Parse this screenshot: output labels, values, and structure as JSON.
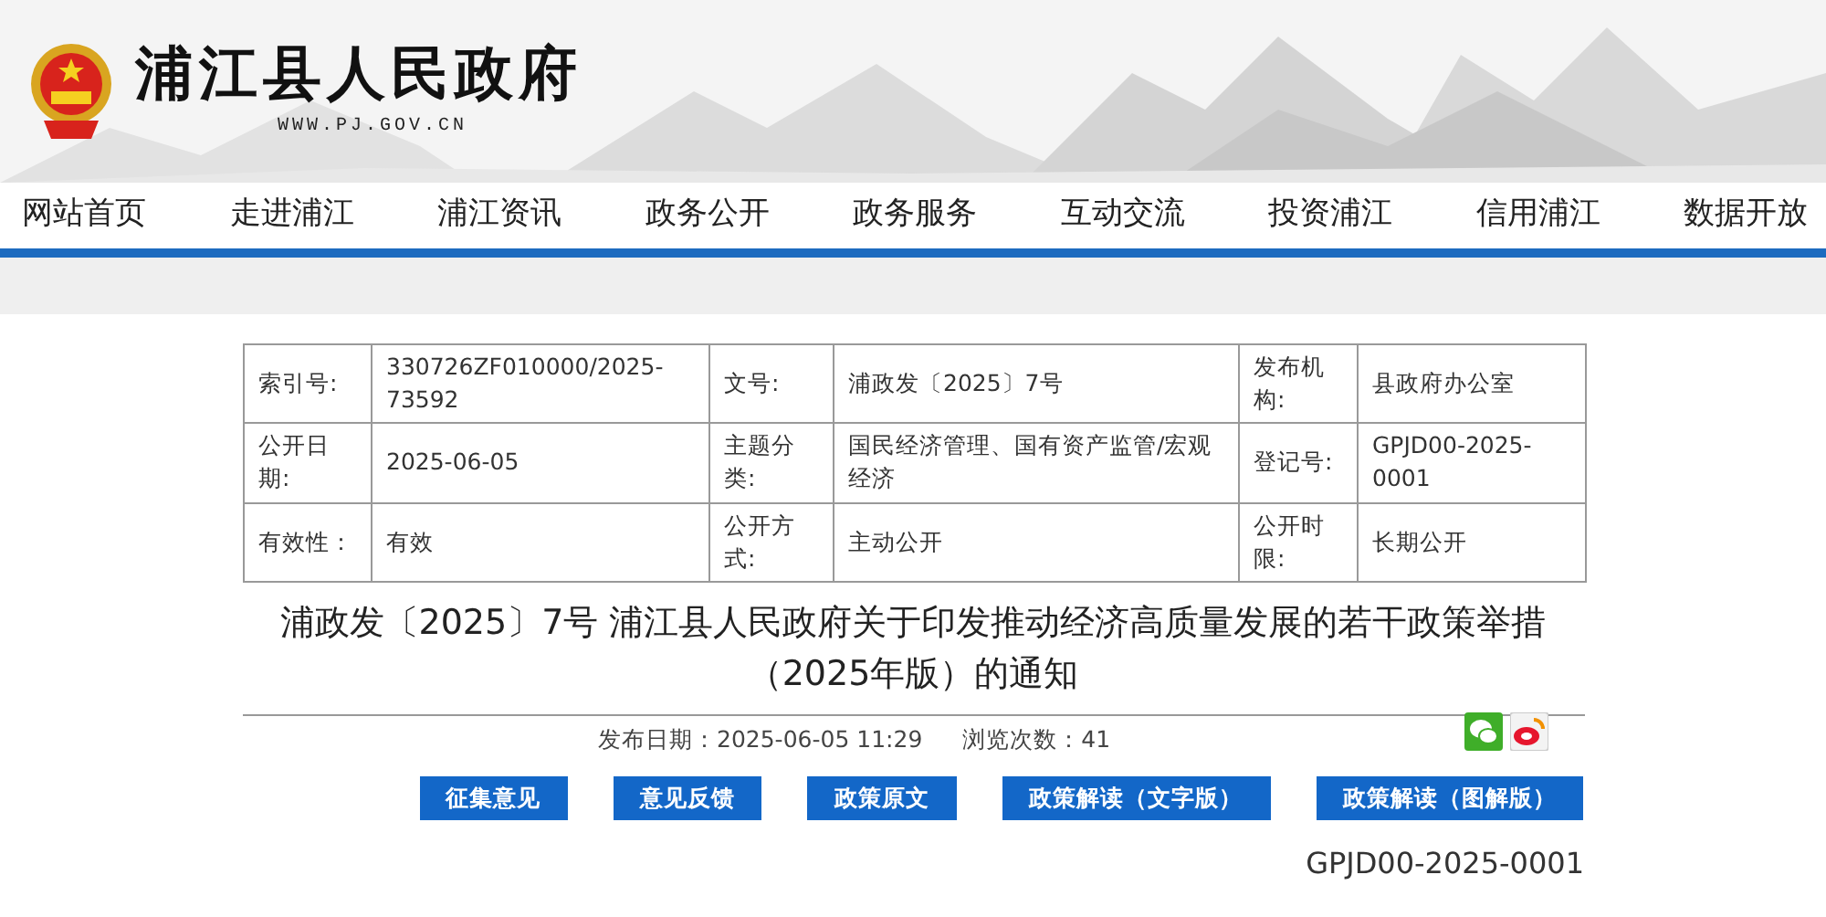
{
  "header": {
    "title": "浦江县人民政府",
    "url": "WWW.PJ.GOV.CN"
  },
  "nav": [
    {
      "label": "网站首页"
    },
    {
      "label": "走进浦江"
    },
    {
      "label": "浦江资讯"
    },
    {
      "label": "政务公开"
    },
    {
      "label": "政务服务"
    },
    {
      "label": "互动交流"
    },
    {
      "label": "投资浦江"
    },
    {
      "label": "信用浦江"
    },
    {
      "label": "数据开放"
    }
  ],
  "info_table": {
    "rows": [
      [
        {
          "label": "索引号:",
          "value": "330726ZF010000/2025-73592"
        },
        {
          "label": "文号:",
          "value": "浦政发〔2025〕7号"
        },
        {
          "label": "发布机构:",
          "value": "县政府办公室"
        }
      ],
      [
        {
          "label": "公开日期:",
          "value": "2025-06-05"
        },
        {
          "label": "主题分类:",
          "value": "国民经济管理、国有资产监管/宏观经济"
        },
        {
          "label": "登记号:",
          "value": "GPJD00-2025-0001"
        }
      ],
      [
        {
          "label": "有效性：",
          "value": "有效"
        },
        {
          "label": "公开方式:",
          "value": "主动公开"
        },
        {
          "label": "公开时限:",
          "value": "长期公开"
        }
      ]
    ]
  },
  "article": {
    "title": "浦政发〔2025〕7号 浦江县人民政府关于印发推动经济高质量发展的若干政策举措（2025年版）的通知",
    "published": "发布日期：2025-06-05 11:29",
    "views": "浏览次数：41"
  },
  "buttons": [
    "征集意见",
    "意见反馈",
    "政策原文",
    "政策解读（文字版）",
    "政策解读（图解版）"
  ],
  "registration": "GPJD00-2025-0001"
}
